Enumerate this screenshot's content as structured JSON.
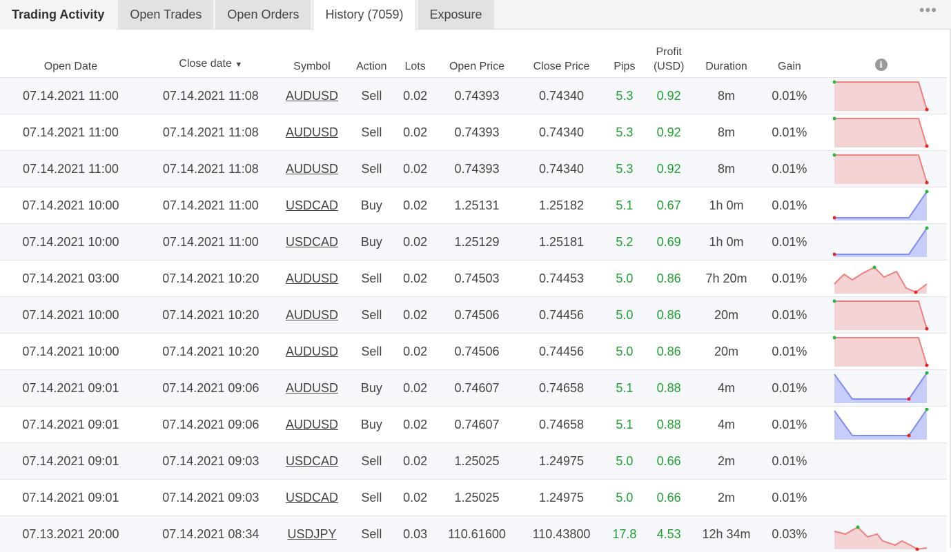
{
  "tabs": {
    "title": "Trading Activity",
    "items": [
      "Open Trades",
      "Open Orders",
      "History (7059)",
      "Exposure"
    ],
    "more": "•••"
  },
  "columns": {
    "open_date": "Open Date",
    "close_date": "Close date",
    "sort_indicator": "▼",
    "symbol": "Symbol",
    "action": "Action",
    "lots": "Lots",
    "open_price": "Open Price",
    "close_price": "Close Price",
    "pips": "Pips",
    "profit_line1": "Profit",
    "profit_line2": "(USD)",
    "duration": "Duration",
    "gain": "Gain",
    "chart_icon": "info-icon"
  },
  "colors": {
    "positive": "#20a030",
    "sell_line": "#f08080",
    "sell_fill": "#f3d3d3",
    "buy_line": "#7f8cf0",
    "buy_fill": "#c6cdf8",
    "high_dot": "#22bb33",
    "low_dot": "#ee2222"
  },
  "rows": [
    {
      "open": "07.14.2021 11:00",
      "close": "07.14.2021 11:08",
      "symbol": "AUDUSD",
      "action": "Sell",
      "lots": "0.02",
      "open_price": "0.74393",
      "close_price": "0.74340",
      "pips": "5.3",
      "profit": "0.92",
      "duration": "8m",
      "gain": "0.01%",
      "spark": "sell_drop"
    },
    {
      "open": "07.14.2021 11:00",
      "close": "07.14.2021 11:08",
      "symbol": "AUDUSD",
      "action": "Sell",
      "lots": "0.02",
      "open_price": "0.74393",
      "close_price": "0.74340",
      "pips": "5.3",
      "profit": "0.92",
      "duration": "8m",
      "gain": "0.01%",
      "spark": "sell_drop"
    },
    {
      "open": "07.14.2021 11:00",
      "close": "07.14.2021 11:08",
      "symbol": "AUDUSD",
      "action": "Sell",
      "lots": "0.02",
      "open_price": "0.74393",
      "close_price": "0.74340",
      "pips": "5.3",
      "profit": "0.92",
      "duration": "8m",
      "gain": "0.01%",
      "spark": "sell_drop"
    },
    {
      "open": "07.14.2021 10:00",
      "close": "07.14.2021 11:00",
      "symbol": "USDCAD",
      "action": "Buy",
      "lots": "0.02",
      "open_price": "1.25131",
      "close_price": "1.25182",
      "pips": "5.1",
      "profit": "0.67",
      "duration": "1h 0m",
      "gain": "0.01%",
      "spark": "buy_rise"
    },
    {
      "open": "07.14.2021 10:00",
      "close": "07.14.2021 11:00",
      "symbol": "USDCAD",
      "action": "Buy",
      "lots": "0.02",
      "open_price": "1.25129",
      "close_price": "1.25181",
      "pips": "5.2",
      "profit": "0.69",
      "duration": "1h 0m",
      "gain": "0.01%",
      "spark": "buy_rise"
    },
    {
      "open": "07.14.2021 03:00",
      "close": "07.14.2021 10:20",
      "symbol": "AUDUSD",
      "action": "Sell",
      "lots": "0.02",
      "open_price": "0.74503",
      "close_price": "0.74453",
      "pips": "5.0",
      "profit": "0.86",
      "duration": "7h 20m",
      "gain": "0.01%",
      "spark": "sell_wave"
    },
    {
      "open": "07.14.2021 10:00",
      "close": "07.14.2021 10:20",
      "symbol": "AUDUSD",
      "action": "Sell",
      "lots": "0.02",
      "open_price": "0.74506",
      "close_price": "0.74456",
      "pips": "5.0",
      "profit": "0.86",
      "duration": "20m",
      "gain": "0.01%",
      "spark": "sell_drop"
    },
    {
      "open": "07.14.2021 10:00",
      "close": "07.14.2021 10:20",
      "symbol": "AUDUSD",
      "action": "Sell",
      "lots": "0.02",
      "open_price": "0.74506",
      "close_price": "0.74456",
      "pips": "5.0",
      "profit": "0.86",
      "duration": "20m",
      "gain": "0.01%",
      "spark": "sell_drop"
    },
    {
      "open": "07.14.2021 09:01",
      "close": "07.14.2021 09:06",
      "symbol": "AUDUSD",
      "action": "Buy",
      "lots": "0.02",
      "open_price": "0.74607",
      "close_price": "0.74658",
      "pips": "5.1",
      "profit": "0.88",
      "duration": "4m",
      "gain": "0.01%",
      "spark": "buy_v"
    },
    {
      "open": "07.14.2021 09:01",
      "close": "07.14.2021 09:06",
      "symbol": "AUDUSD",
      "action": "Buy",
      "lots": "0.02",
      "open_price": "0.74607",
      "close_price": "0.74658",
      "pips": "5.1",
      "profit": "0.88",
      "duration": "4m",
      "gain": "0.01%",
      "spark": "buy_v"
    },
    {
      "open": "07.14.2021 09:01",
      "close": "07.14.2021 09:03",
      "symbol": "USDCAD",
      "action": "Sell",
      "lots": "0.02",
      "open_price": "1.25025",
      "close_price": "1.24975",
      "pips": "5.0",
      "profit": "0.66",
      "duration": "2m",
      "gain": "0.01%",
      "spark": "none"
    },
    {
      "open": "07.14.2021 09:01",
      "close": "07.14.2021 09:03",
      "symbol": "USDCAD",
      "action": "Sell",
      "lots": "0.02",
      "open_price": "1.25025",
      "close_price": "1.24975",
      "pips": "5.0",
      "profit": "0.66",
      "duration": "2m",
      "gain": "0.01%",
      "spark": "none"
    },
    {
      "open": "07.13.2021 20:00",
      "close": "07.14.2021 08:34",
      "symbol": "USDJPY",
      "action": "Sell",
      "lots": "0.03",
      "open_price": "110.61600",
      "close_price": "110.43800",
      "pips": "17.8",
      "profit": "4.53",
      "duration": "12h 34m",
      "gain": "0.03%",
      "spark": "sell_jagged"
    }
  ]
}
